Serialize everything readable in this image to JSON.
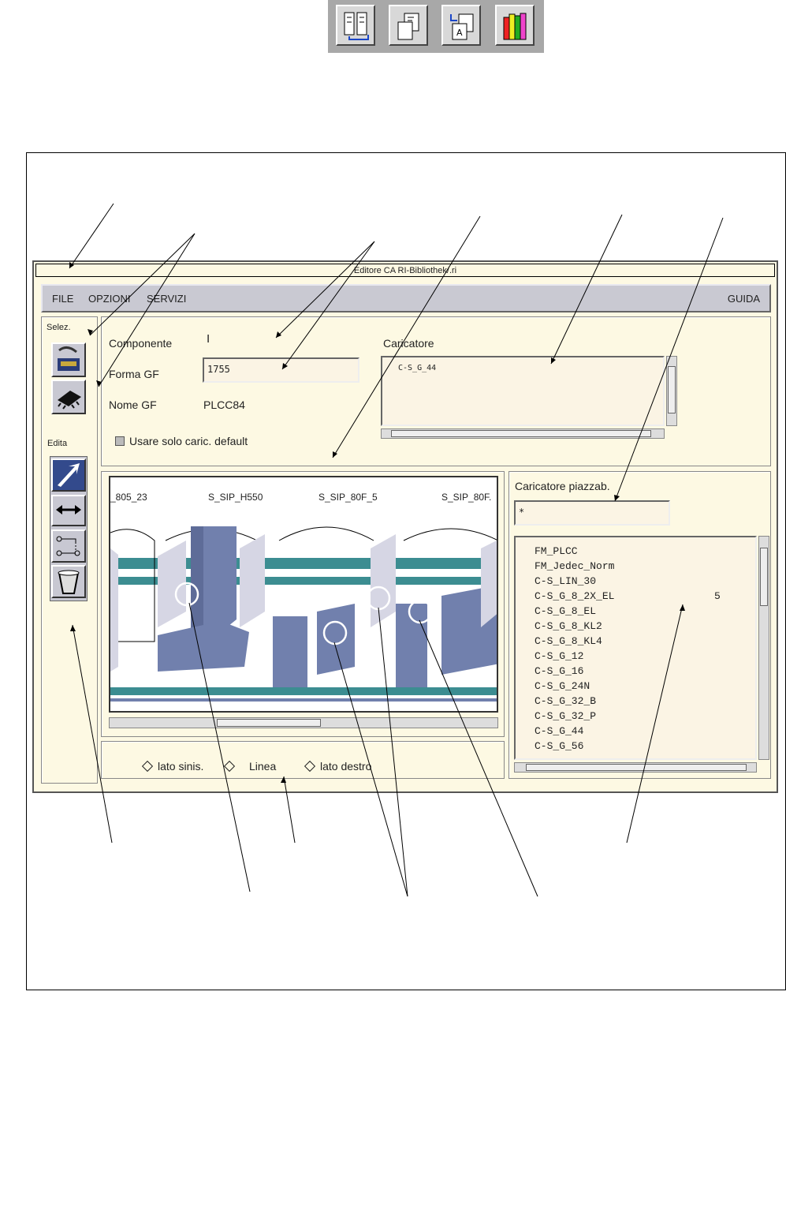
{
  "window": {
    "title": "Editore CA RI-Bibliothek/.ri"
  },
  "menu": {
    "items": [
      "FILE",
      "OPZIONI",
      "SERVIZI"
    ],
    "help": "GUIDA"
  },
  "sidebar": {
    "select_label": "Selez.",
    "edit_label": "Edita"
  },
  "form": {
    "componente_label": "Componente",
    "componente_value": "I",
    "forma_label": "Forma GF",
    "forma_value": "1755",
    "nome_label": "Nome GF",
    "nome_value": "PLCC84",
    "checkbox_label": "Usare solo caric. default"
  },
  "caricatore": {
    "label": "Caricatore",
    "items": [
      "C-S_G_44"
    ]
  },
  "canvas": {
    "labels": [
      "_805_23",
      "S_SIP_H550",
      "S_SIP_80F_5",
      "S_SIP_80F."
    ]
  },
  "piazzab": {
    "label": "Caricatore piazzab.",
    "filter": "*",
    "items": [
      "FM_PLCC",
      "FM_Jedec_Norm",
      "C-S_LIN_30",
      "C-S_G_8_2X_EL",
      "C-S_G_8_EL",
      "C-S_G_8_KL2",
      "C-S_G_8_KL4",
      "C-S_G_12",
      "C-S_G_16",
      "C-S_G_24N",
      "C-S_G_32_B",
      "C-S_G_32_P",
      "C-S_G_44",
      "C-S_G_56"
    ],
    "count": "5"
  },
  "view": {
    "options": [
      "lato sinis.",
      "Linea",
      "lato destro"
    ]
  },
  "colors": {
    "panel": "#fdf9e3",
    "menubar": "#c9c9d2",
    "steel": "#7180ad",
    "teal": "#3c8d91",
    "lavender": "#d6d6e4"
  }
}
